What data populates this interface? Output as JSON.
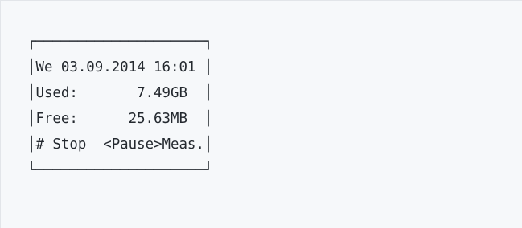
{
  "lcd_display": {
    "border_top": "┌────────────────────┐",
    "lines": [
      "│We 03.09.2014 16:01 │",
      "│Used:       7.49GB  │",
      "│Free:      25.63MB  │",
      "│# Stop  <Pause>Meas.│"
    ],
    "border_bottom": "└────────────────────┘"
  }
}
